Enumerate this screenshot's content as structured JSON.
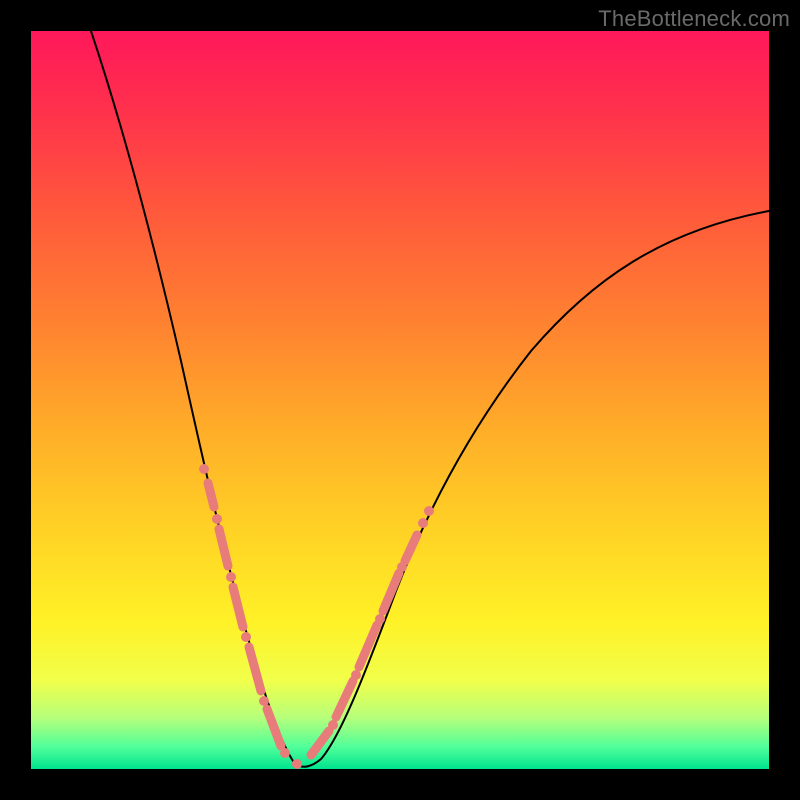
{
  "watermark": "TheBottleneck.com",
  "colors": {
    "background": "#000000",
    "gradient_top": "#ff185a",
    "gradient_mid": "#ffd825",
    "gradient_bottom": "#00e38e",
    "curve": "#000000",
    "overlay": "#e77c7a"
  },
  "chart_data": {
    "type": "line",
    "title": "",
    "xlabel": "",
    "ylabel": "",
    "xlim": [
      0,
      100
    ],
    "ylim": [
      0,
      100
    ],
    "grid": false,
    "legend": false,
    "note": "Axes are normalized 0–100; no numeric tick labels are shown in the image. Y values estimated from pixel positions (0 at bottom, 100 at top).",
    "series": [
      {
        "name": "curve",
        "x": [
          8,
          10,
          12,
          14,
          16,
          18,
          20,
          22,
          24,
          26,
          28,
          30,
          32,
          34,
          36,
          38,
          40,
          45,
          50,
          55,
          60,
          65,
          70,
          75,
          80,
          85,
          90,
          95,
          100
        ],
        "y": [
          100,
          92,
          84,
          76,
          68,
          60,
          52,
          44,
          36,
          27,
          19,
          12,
          6,
          2,
          0,
          0,
          3,
          12,
          22,
          31,
          39,
          46,
          52,
          57,
          61,
          64,
          67,
          69,
          71
        ]
      }
    ],
    "overlay_segments": {
      "description": "salmon bead/dash overlay on the curve (approx x-ranges, normalized)",
      "left_branch": [
        [
          22,
          24
        ],
        [
          24.5,
          27
        ],
        [
          27.5,
          30
        ],
        [
          30.5,
          33
        ]
      ],
      "right_branch": [
        [
          37,
          41
        ],
        [
          41.5,
          45
        ],
        [
          45.5,
          48.5
        ],
        [
          49,
          51
        ]
      ],
      "loose_dots_x": [
        21.5,
        33.5,
        36.5,
        52
      ]
    }
  }
}
